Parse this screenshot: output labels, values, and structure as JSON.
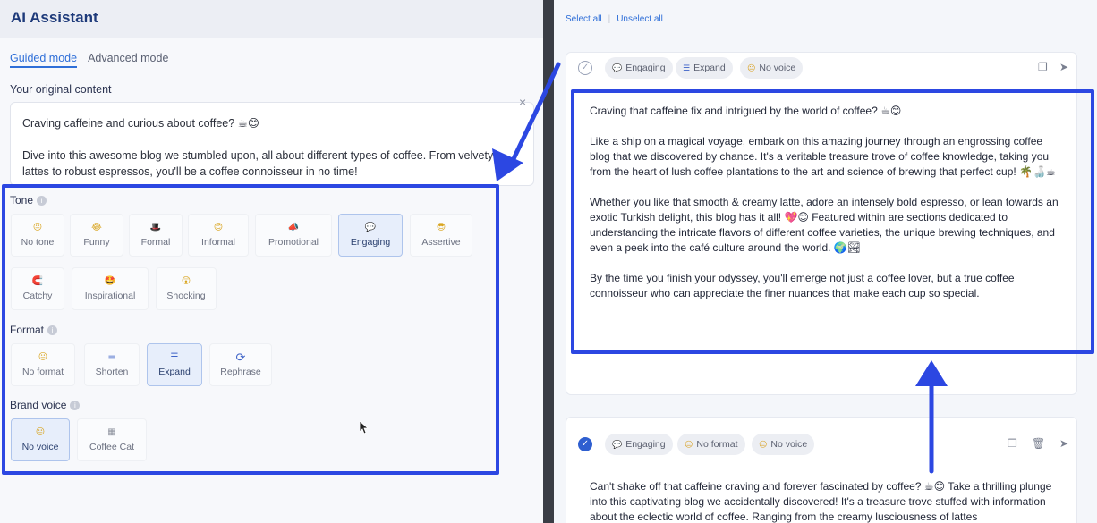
{
  "left": {
    "title": "AI Assistant",
    "modes": [
      "Guided mode",
      "Advanced mode"
    ],
    "original_label": "Your original content",
    "original_text": [
      "Craving caffeine and curious about coffee? ☕😊",
      "Dive into this awesome blog we stumbled upon, all about different types of coffee. From velvety lattes to robust espressos, you'll be a coffee connoisseur in no time!"
    ],
    "close_icon": "×",
    "tone_label": "Tone",
    "tone_options": [
      {
        "label": "No tone",
        "icon": "😐"
      },
      {
        "label": "Funny",
        "icon": "😂"
      },
      {
        "label": "Formal",
        "icon": "🎩"
      },
      {
        "label": "Informal",
        "icon": "😊"
      },
      {
        "label": "Promotional",
        "icon": "📣"
      },
      {
        "label": "Engaging",
        "icon": "💬"
      },
      {
        "label": "Assertive",
        "icon": "😎"
      },
      {
        "label": "Catchy",
        "icon": "🧲"
      },
      {
        "label": "Inspirational",
        "icon": "🤩"
      },
      {
        "label": "Shocking",
        "icon": "😲"
      }
    ],
    "format_label": "Format",
    "format_options": [
      {
        "label": "No format",
        "icon": "😐"
      },
      {
        "label": "Shorten",
        "icon": "═"
      },
      {
        "label": "Expand",
        "icon": "☰"
      },
      {
        "label": "Rephrase",
        "icon": "⟳"
      }
    ],
    "brand_label": "Brand voice",
    "brand_options": [
      {
        "label": "No voice",
        "icon": "😐"
      },
      {
        "label": "Coffee Cat",
        "icon": "▦"
      }
    ],
    "selected": {
      "tone": "Engaging",
      "format": "Expand",
      "brand": "No voice"
    }
  },
  "right": {
    "select_all": "Select all",
    "unselect_all": "Unselect all",
    "card1": {
      "chips": [
        {
          "label": "Engaging",
          "icon": "💬"
        },
        {
          "label": "Expand",
          "icon": "☰"
        },
        {
          "label": "No voice",
          "icon": "😐"
        }
      ],
      "text": [
        "Craving that caffeine fix and intrigued by the world of coffee? ☕😊",
        "Like a ship on a magical voyage, embark on this amazing journey through an engrossing coffee blog that we discovered by chance. It's a veritable treasure trove of coffee knowledge, taking you from the heart of lush coffee plantations to the art and science of brewing that perfect cup! 🌴🍶☕",
        "Whether you like that smooth & creamy latte, adore an intensely bold espresso, or lean towards an exotic Turkish delight, this blog has it all! 💖😊 Featured within are sections dedicated to understanding the intricate flavors of different coffee varieties, the unique brewing techniques, and even a peek into the café culture around the world. 🌍🏞",
        "By the time you finish your odyssey, you'll emerge not just a coffee lover, but a true coffee connoisseur who can appreciate the finer nuances that make each cup so special."
      ]
    },
    "card2": {
      "chips": [
        {
          "label": "Engaging",
          "icon": "💬"
        },
        {
          "label": "No format",
          "icon": "😐"
        },
        {
          "label": "No voice",
          "icon": "😐"
        }
      ],
      "text": "Can't shake off that caffeine craving and forever fascinated by coffee? ☕😊 Take a thrilling plunge into this captivating blog we accidentally discovered! It's a treasure trove stuffed with information about the eclectic world of coffee. Ranging from the creamy lusciousness of lattes"
    }
  },
  "colors": {
    "highlight": "#2c47e2",
    "accent": "#2f6fd8"
  }
}
